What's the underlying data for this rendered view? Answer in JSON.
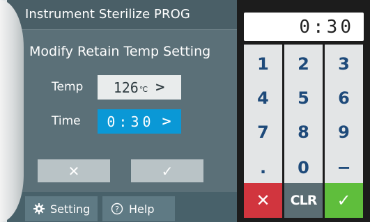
{
  "title": "Instrument Sterilize PROG",
  "heading": "Modify Retain Temp Setting",
  "temp": {
    "label": "Temp",
    "value": "126",
    "unit": "℃",
    "chevron": ">"
  },
  "time": {
    "label": "Time",
    "value": "0:30",
    "chevron": ">"
  },
  "cancel_icon": "✕",
  "confirm_icon": "✓",
  "tabs": {
    "setting": "Setting",
    "help": "Help"
  },
  "keypad": {
    "display": "0:30",
    "keys": [
      "1",
      "2",
      "3",
      "4",
      "5",
      "6",
      "7",
      "8",
      "9",
      ".",
      "0",
      "−"
    ],
    "clear": "CLR",
    "cancel_icon": "✕",
    "confirm_icon": "✓"
  },
  "colors": {
    "panel": "#5b7078",
    "selected_field": "#0a98d6",
    "cancel": "#d1353e",
    "confirm": "#5fbe3c"
  }
}
